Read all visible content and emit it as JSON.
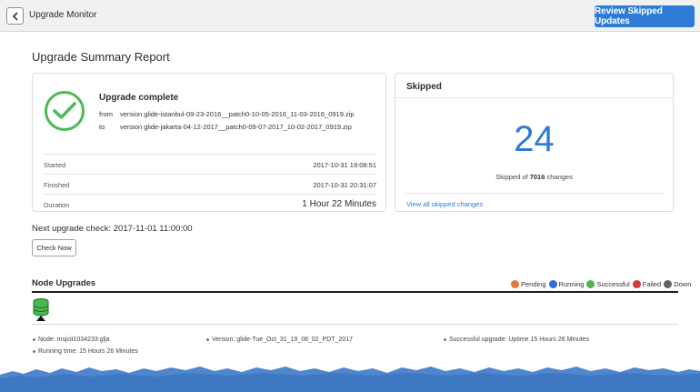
{
  "topbar": {
    "title": "Upgrade Monitor",
    "review_button": "Review Skipped Updates"
  },
  "report": {
    "title": "Upgrade Summary Report"
  },
  "upgrade": {
    "status_title": "Upgrade complete",
    "from_label": "from",
    "from_version": "version glide-istanbul-09-23-2016__patch0-10-05-2016_11-03-2016_0919.zip",
    "to_label": "to",
    "to_version": "version glide-jakarta-04-12-2017__patch0-09-07-2017_10-02-2017_0919.zip",
    "stats": [
      {
        "label": "Started",
        "value": "2017-10-31 19:08:51"
      },
      {
        "label": "Finished",
        "value": "2017-10-31 20:31:07"
      },
      {
        "label": "Duration",
        "value": "1 Hour 22 Minutes"
      }
    ]
  },
  "skipped": {
    "title": "Skipped",
    "count": "24",
    "sub_prefix": "Skipped of",
    "total": "7016",
    "sub_suffix": "changes",
    "link": "View all skipped changes"
  },
  "next_check": "Next upgrade check: 2017-11-01 11:00:00",
  "check_now_button": "Check Now",
  "node_upgrades": {
    "title": "Node Upgrades",
    "legend": [
      {
        "label": "Pending",
        "color": "#e07a3c"
      },
      {
        "label": "Running",
        "color": "#2e6fd0"
      },
      {
        "label": "Successful",
        "color": "#4cb84f"
      },
      {
        "label": "Failed",
        "color": "#d9363e"
      },
      {
        "label": "Down",
        "color": "#5d6368"
      }
    ],
    "node_color": "#4cb84f",
    "info": {
      "node": "Node: msjcit1034233:glja",
      "version": "Version: glide-Tue_Oct_31_19_08_02_PDT_2017",
      "successful": "Successful upgrade: Uptime 15 Hours 26 Minutes",
      "running_time": "Running time: 15 Hours 26 Minutes"
    }
  }
}
